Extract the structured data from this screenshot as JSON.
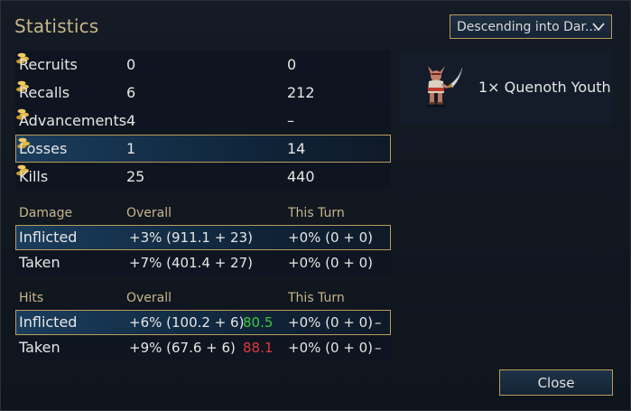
{
  "dialog": {
    "title": "Statistics",
    "scenario_select": {
      "value": "Descending into Dar..."
    },
    "close_label": "Close"
  },
  "summary_rows": [
    {
      "label": "Recruits",
      "value": "0",
      "cost": "0"
    },
    {
      "label": "Recalls",
      "value": "6",
      "cost": "212"
    },
    {
      "label": "Advancements",
      "value": "4",
      "cost": "–"
    },
    {
      "label": "Losses",
      "value": "1",
      "cost": "14"
    },
    {
      "label": "Kills",
      "value": "25",
      "cost": "440"
    }
  ],
  "damage": {
    "header": {
      "label": "Damage",
      "overall": "Overall",
      "this_turn": "This Turn"
    },
    "rows": [
      {
        "label": "Inflicted",
        "overall": "+3% (911.1 + 23)",
        "this_turn": "+0% (0 + 0)"
      },
      {
        "label": "Taken",
        "overall": "+7% (401.4 + 27)",
        "this_turn": "+0% (0 + 0)"
      }
    ]
  },
  "hits": {
    "header": {
      "label": "Hits",
      "overall": "Overall",
      "this_turn": "This Turn"
    },
    "rows": [
      {
        "label": "Inflicted",
        "overall": "+6% (100.2 + 6)",
        "pct": "80.5",
        "this_turn": "+0% (0 + 0)",
        "dash": "–"
      },
      {
        "label": "Taken",
        "overall": "+9% (67.6 + 6)",
        "pct": "88.1",
        "this_turn": "+0% (0 + 0)",
        "dash": "–"
      }
    ]
  },
  "unit_list": [
    {
      "label": "1× Quenoth Youth",
      "icon": "quenoth-youth-sprite"
    }
  ],
  "colors": {
    "accent_gold": "#c8b58a",
    "highlight_border": "#b99b5a",
    "good": "#3fc43f",
    "bad": "#e03a3a"
  }
}
